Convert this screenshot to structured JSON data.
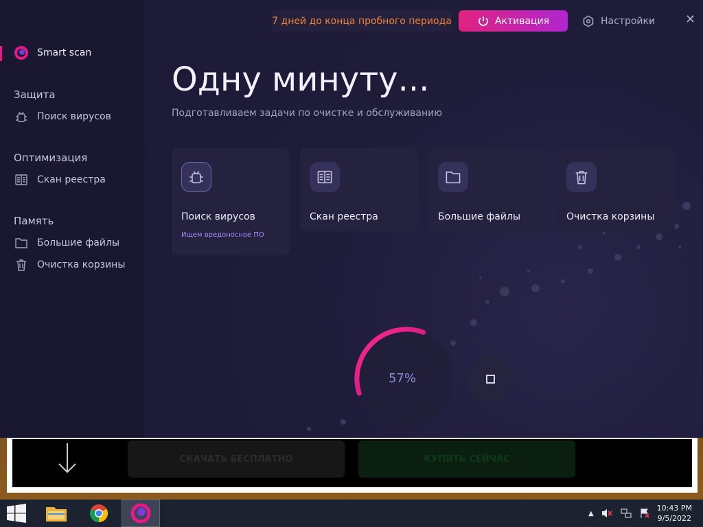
{
  "sidebar": {
    "smart_scan": "Smart scan",
    "sections": [
      {
        "title": "Защита",
        "items": [
          {
            "label": "Поиск вирусов",
            "icon": "bug-icon"
          }
        ]
      },
      {
        "title": "Оптимизация",
        "items": [
          {
            "label": "Скан реестра",
            "icon": "registry-book-icon"
          }
        ]
      },
      {
        "title": "Память",
        "items": [
          {
            "label": "Большие файлы",
            "icon": "folder-icon"
          },
          {
            "label": "Очистка корзины",
            "icon": "trash-icon"
          }
        ]
      }
    ]
  },
  "topbar": {
    "trial_text": "7 дней до конца пробного периода",
    "activate_label": "Активация",
    "settings_label": "Настройки",
    "minimize": "–",
    "close": "✕"
  },
  "main": {
    "title": "Одну минуту...",
    "subtitle": "Подготавливаем задачи по очистке и обслуживанию",
    "cards": [
      {
        "label": "Поиск вирусов",
        "status": "Ищем вредоносное ПО",
        "icon": "bug-icon"
      },
      {
        "label": "Скан реестра",
        "icon": "registry-book-icon"
      },
      {
        "label": "Большие файлы",
        "icon": "folder-icon"
      },
      {
        "label": "Очистка корзины",
        "icon": "trash-icon"
      }
    ],
    "progress_label": "57%",
    "progress_value": 0.57
  },
  "background_window": {
    "free_label": "СКАЧАТЬ БЕСПЛАТНО",
    "buy_label": "КУПИТЬ СЕЙЧАС"
  },
  "taskbar": {
    "time": "10:43 PM",
    "date": "9/5/2022"
  },
  "colors": {
    "accent_magenta": "#e0237f",
    "accent_purple": "#b025d0",
    "trial_orange": "#f2813a",
    "bg_dark": "#1b1934"
  }
}
